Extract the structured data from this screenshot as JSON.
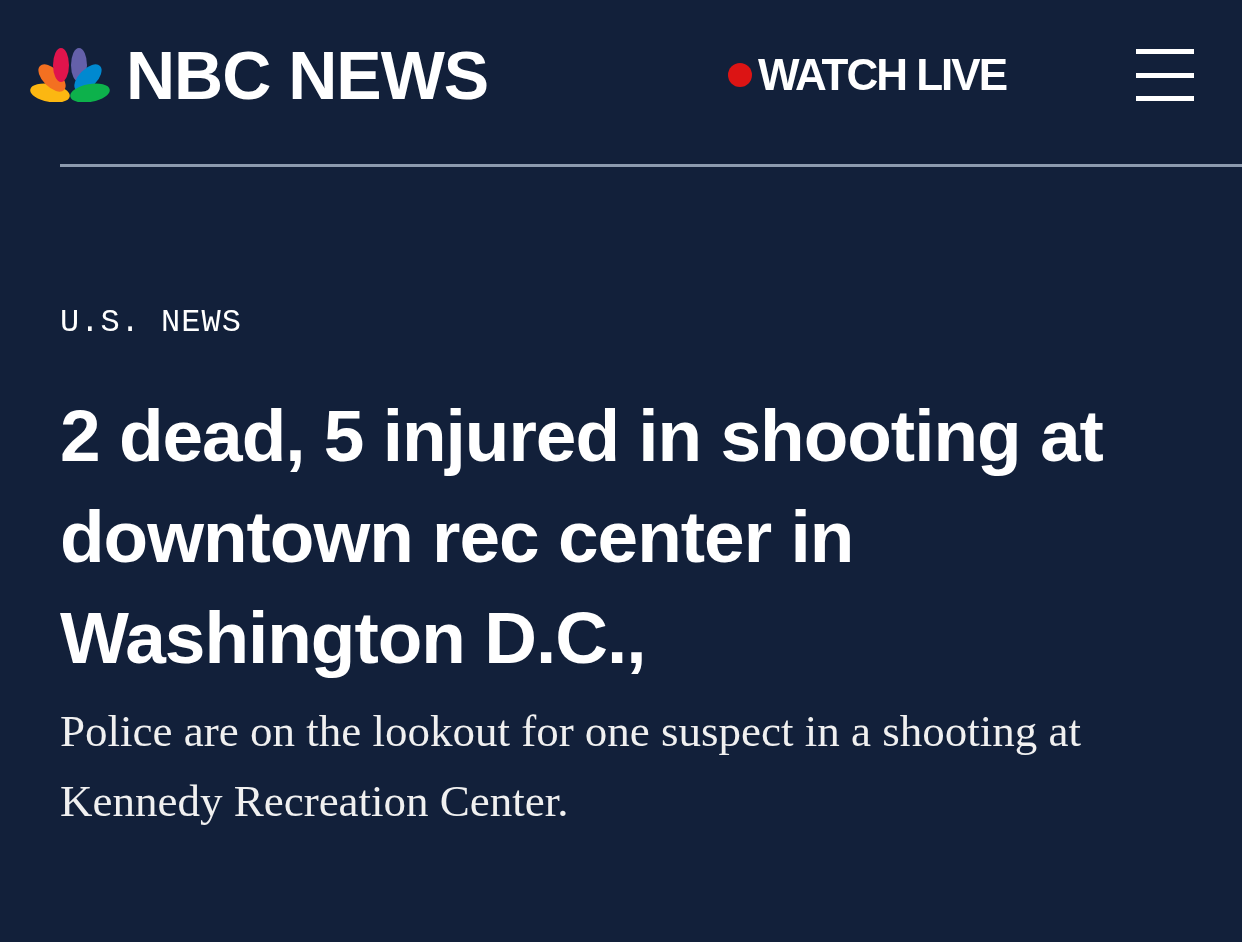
{
  "header": {
    "brand": "NBC NEWS",
    "watch_live": "WATCH LIVE"
  },
  "article": {
    "section": "U.S. NEWS",
    "headline": "2 dead, 5 injured in shooting at downtown rec center in Washington D.C.,",
    "dek": "Police are on the lookout for one suspect in a shooting at Kennedy Recreation Center."
  }
}
